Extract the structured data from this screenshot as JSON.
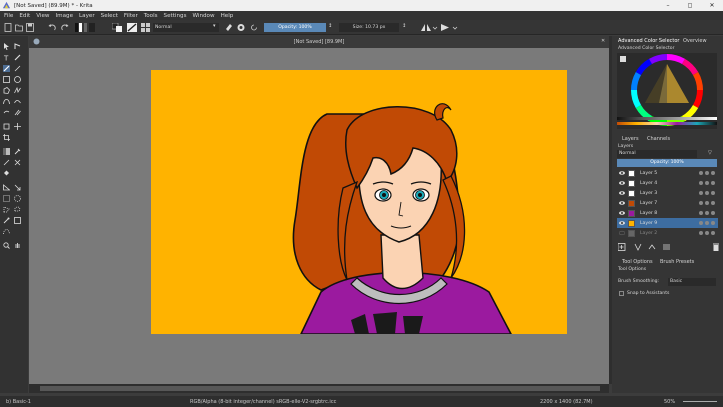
{
  "window": {
    "title": "[Not Saved]  (89.9M) * - Krita",
    "min": "–",
    "max": "◻",
    "close": "✕"
  },
  "menu": [
    "File",
    "Edit",
    "View",
    "Image",
    "Layer",
    "Select",
    "Filter",
    "Tools",
    "Settings",
    "Window",
    "Help"
  ],
  "toolbar": {
    "blend_mode": "Normal",
    "opacity_label": "Opacity: 100%",
    "size_label": "Size: 10.73 px"
  },
  "document": {
    "tab_title": "[Not Saved]  [89.9M]"
  },
  "color_panel": {
    "tab_selector": "Advanced Color Selector",
    "tab_overview": "Overview",
    "title": "Advanced Color Selector"
  },
  "layers_panel": {
    "tab_layers": "Layers",
    "tab_channels": "Channels",
    "title": "Layers",
    "blend_mode": "Normal",
    "opacity": "Opacity: 100%",
    "layers": [
      {
        "name": "Layer 5"
      },
      {
        "name": "Layer 4"
      },
      {
        "name": "Layer 3"
      },
      {
        "name": "Layer 7"
      },
      {
        "name": "Layer 8"
      },
      {
        "name": "Layer 9"
      },
      {
        "name": "Layer 2"
      }
    ]
  },
  "tool_options": {
    "tab_tool_options": "Tool Options",
    "tab_brush_presets": "Brush Presets",
    "title": "Tool Options",
    "smoothing_label": "Brush Smoothing:",
    "smoothing_value": "Basic",
    "snap_label": "Snap to Assistants"
  },
  "status": {
    "brush": "b) Basic-1",
    "colorspace": "RGB/Alpha (8-bit integer/channel)  sRGB-elle-V2-srgbtrc.icc",
    "dimensions": "2200 x 1400 (82.7M)",
    "zoom": "50%"
  },
  "colors": {
    "canvas_bg": "#ffb300",
    "hair": "#c14a05",
    "shirt": "#9b1a9f",
    "skin": "#fbd3b3",
    "selection": "#3d6da1",
    "opacity_bar": "#5a89b8"
  }
}
